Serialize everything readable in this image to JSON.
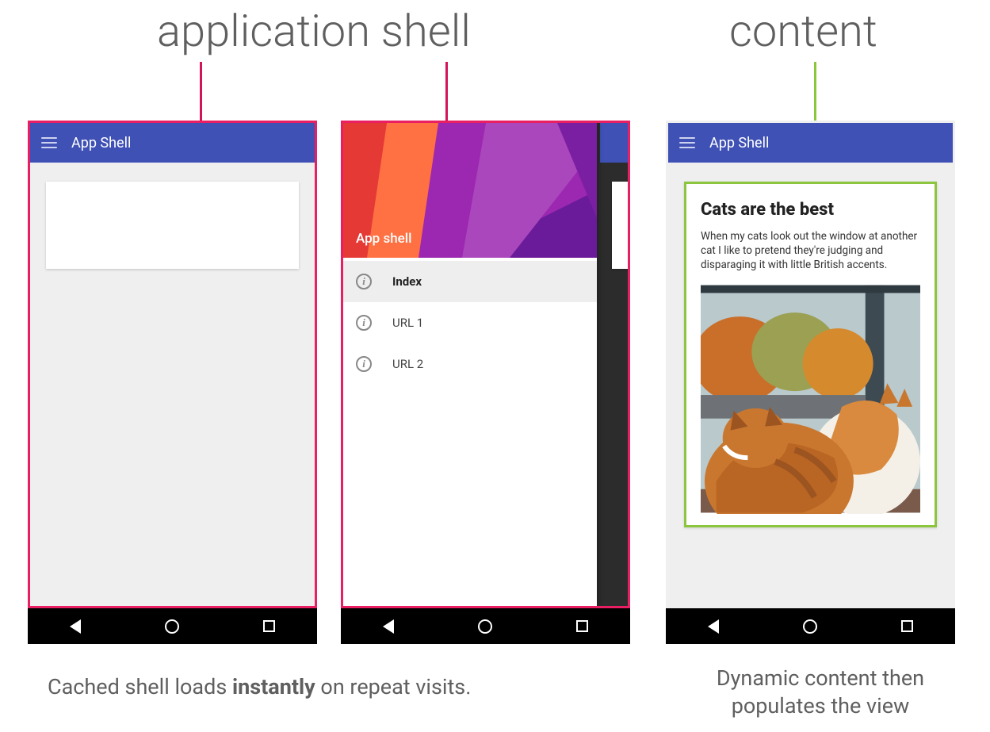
{
  "labels": {
    "app_shell": "application shell",
    "content": "content"
  },
  "colors": {
    "pink": "#e91e63",
    "green": "#8cc63f",
    "toolbar": "#3f51b5"
  },
  "phone1": {
    "toolbar_title": "App Shell"
  },
  "phone2": {
    "drawer_title": "App shell",
    "nav": [
      {
        "label": "Index",
        "active": true
      },
      {
        "label": "URL 1",
        "active": false
      },
      {
        "label": "URL 2",
        "active": false
      }
    ]
  },
  "phone3": {
    "toolbar_title": "App Shell",
    "article": {
      "heading": "Cats are the best",
      "body": "When my cats look out the window at another cat I like to pretend they're judging and disparaging it with little British accents."
    }
  },
  "captions": {
    "left_pre": "Cached shell loads ",
    "left_bold": "instantly",
    "left_post": " on repeat visits.",
    "right": "Dynamic content then populates the view"
  }
}
